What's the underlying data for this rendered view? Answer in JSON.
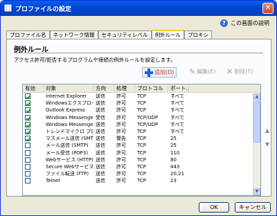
{
  "window": {
    "title": "プロファイルの設定"
  },
  "help": {
    "label": "この画面の説明"
  },
  "tabs": [
    {
      "label": "プロファイル名"
    },
    {
      "label": "ネットワーク情報"
    },
    {
      "label": "セキュリティレベル"
    },
    {
      "label": "例外ルール"
    },
    {
      "label": "プロキシ"
    }
  ],
  "section": {
    "title": "例外ルール",
    "description": "アクセス許可/拒否するプログラムや接続の例外ルールを設定します。"
  },
  "toolbar": {
    "add_label": "追加(D)",
    "edit_label": "編集(E)",
    "delete_label": "削除(T)"
  },
  "table": {
    "columns": [
      "有効",
      "対象",
      "方向",
      "処理",
      "プロトコル",
      "ポート..."
    ],
    "rows": [
      {
        "enabled": true,
        "target": "Internet Explorer",
        "direction": "送信",
        "action": "許可",
        "protocol": "TCP",
        "port": "すべて"
      },
      {
        "enabled": true,
        "target": "Windowsエクスプローラ",
        "direction": "送信",
        "action": "許可",
        "protocol": "TCP",
        "port": "すべて"
      },
      {
        "enabled": true,
        "target": "Outlook Express",
        "direction": "送信",
        "action": "許可",
        "protocol": "TCP",
        "port": "すべて"
      },
      {
        "enabled": true,
        "target": "Windows Messenger (受...",
        "direction": "受信",
        "action": "許可",
        "protocol": "TCP/UDP",
        "port": "すべて"
      },
      {
        "enabled": true,
        "target": "Windows Messenger (送...",
        "direction": "送信",
        "action": "許可",
        "protocol": "TCP/UDP",
        "port": "すべて"
      },
      {
        "enabled": true,
        "target": "トレンドマイクロ プロキシモジ...",
        "direction": "送信",
        "action": "許可",
        "protocol": "TCP",
        "port": "すべて"
      },
      {
        "enabled": true,
        "target": "マスメール送信 (SMTP)",
        "direction": "送信",
        "action": "警告",
        "protocol": "TCP",
        "port": "25"
      },
      {
        "enabled": false,
        "target": "メール送信 (SMTP)",
        "direction": "送信",
        "action": "許可",
        "protocol": "TCP",
        "port": "25"
      },
      {
        "enabled": false,
        "target": "メール受信 (POP3)",
        "direction": "送信",
        "action": "許可",
        "protocol": "TCP",
        "port": "110"
      },
      {
        "enabled": false,
        "target": "Webサービス (HTTP)",
        "direction": "送信",
        "action": "許可",
        "protocol": "TCP",
        "port": "80"
      },
      {
        "enabled": false,
        "target": "Secure Webサービス (HTT...",
        "direction": "送信",
        "action": "許可",
        "protocol": "TCP",
        "port": "443"
      },
      {
        "enabled": false,
        "target": "ファイル転送 (FTP)",
        "direction": "送信",
        "action": "許可",
        "protocol": "TCP",
        "port": "20,21"
      },
      {
        "enabled": false,
        "target": "Telnet",
        "direction": "送信",
        "action": "許可",
        "protocol": "TCP",
        "port": "23"
      }
    ]
  },
  "buttons": {
    "ok_label": "OK",
    "cancel_label": "キャンセル"
  }
}
